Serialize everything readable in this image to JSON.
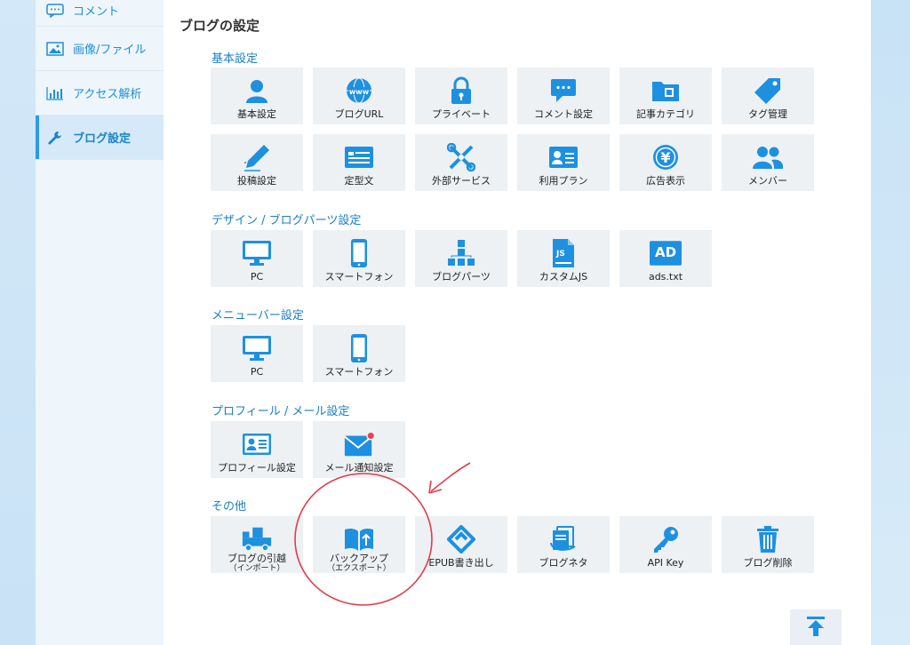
{
  "sidebar": {
    "items": [
      {
        "label": "コメント",
        "icon": "comment-icon"
      },
      {
        "label": "画像/ファイル",
        "icon": "image-icon"
      },
      {
        "label": "アクセス解析",
        "icon": "chart-icon"
      },
      {
        "label": "ブログ設定",
        "icon": "wrench-icon"
      }
    ]
  },
  "main": {
    "title": "ブログの設定",
    "sections": {
      "basic": {
        "title": "基本設定",
        "tiles": [
          "基本設定",
          "ブログURL",
          "プライベート",
          "コメント設定",
          "記事カテゴリ",
          "タグ管理",
          "投稿設定",
          "定型文",
          "外部サービス",
          "利用プラン",
          "広告表示",
          "メンバー"
        ]
      },
      "design": {
        "title": "デザイン / ブログパーツ設定",
        "tiles": [
          "PC",
          "スマートフォン",
          "ブログパーツ",
          "カスタムJS",
          "ads.txt"
        ],
        "js_badge": "JS",
        "ad_badge": "AD"
      },
      "menubar": {
        "title": "メニューバー設定",
        "tiles": [
          "PC",
          "スマートフォン"
        ]
      },
      "profile": {
        "title": "プロフィール / メール設定",
        "tiles": [
          "プロフィール設定",
          "メール通知設定"
        ]
      },
      "other": {
        "title": "その他",
        "tiles": [
          {
            "label": "ブログの引越",
            "sub": "（インポート）"
          },
          {
            "label": "バックアップ",
            "sub": "（エクスポート）"
          },
          {
            "label": "EPUB書き出し",
            "sub": ""
          },
          {
            "label": "ブログネタ",
            "sub": ""
          },
          {
            "label": "API Key",
            "sub": ""
          },
          {
            "label": "ブログ削除",
            "sub": ""
          }
        ]
      }
    }
  },
  "colors": {
    "accent": "#1e90e0",
    "tile_bg": "#edf1f4",
    "annotation": "#e23b4a"
  }
}
